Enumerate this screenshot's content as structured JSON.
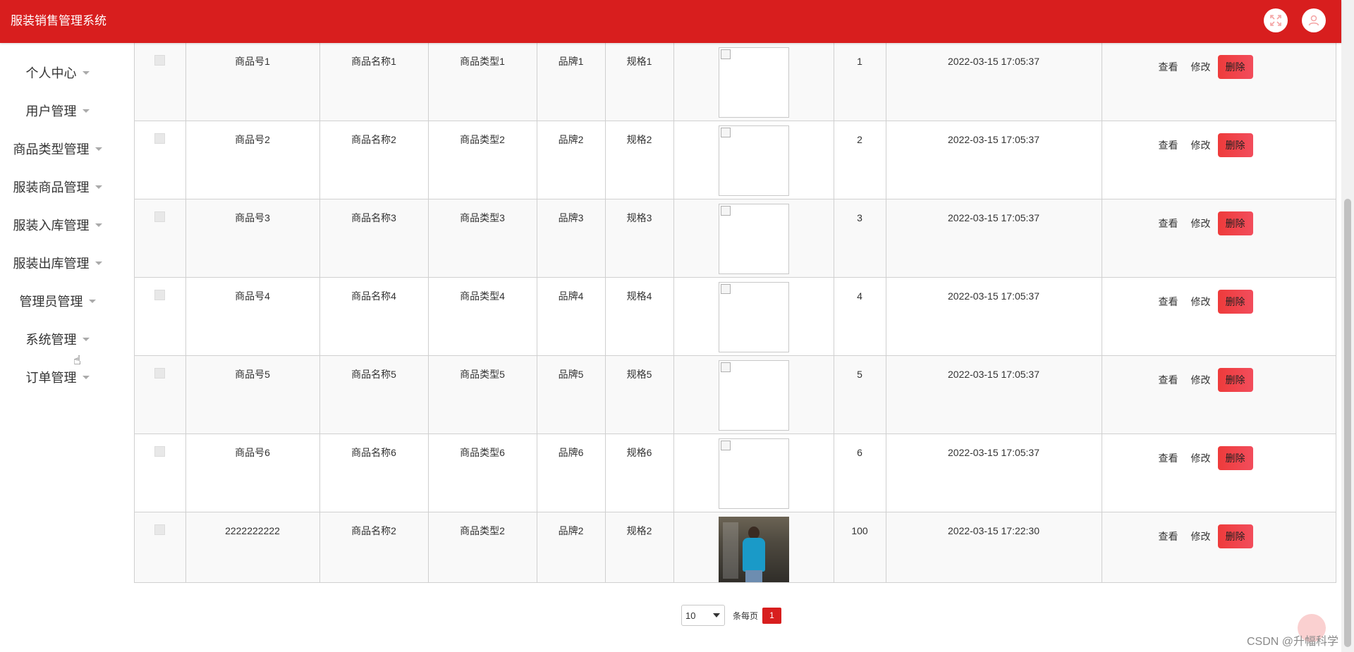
{
  "app": {
    "title": "服装销售管理系统"
  },
  "header": {
    "fullscreen_icon": "fullscreen-icon",
    "user_icon": "user-icon"
  },
  "sidebar": {
    "items": [
      {
        "label": "个人中心"
      },
      {
        "label": "用户管理"
      },
      {
        "label": "商品类型管理"
      },
      {
        "label": "服装商品管理"
      },
      {
        "label": "服装入库管理"
      },
      {
        "label": "服装出库管理"
      },
      {
        "label": "管理员管理"
      },
      {
        "label": "系统管理"
      },
      {
        "label": "订单管理"
      }
    ]
  },
  "table": {
    "rows": [
      {
        "code": "商品号1",
        "name": "商品名称1",
        "type": "商品类型1",
        "brand": "品牌1",
        "spec": "规格1",
        "image": "broken",
        "qty": "1",
        "time": "2022-03-15 17:05:37"
      },
      {
        "code": "商品号2",
        "name": "商品名称2",
        "type": "商品类型2",
        "brand": "品牌2",
        "spec": "规格2",
        "image": "broken",
        "qty": "2",
        "time": "2022-03-15 17:05:37"
      },
      {
        "code": "商品号3",
        "name": "商品名称3",
        "type": "商品类型3",
        "brand": "品牌3",
        "spec": "规格3",
        "image": "broken",
        "qty": "3",
        "time": "2022-03-15 17:05:37"
      },
      {
        "code": "商品号4",
        "name": "商品名称4",
        "type": "商品类型4",
        "brand": "品牌4",
        "spec": "规格4",
        "image": "broken",
        "qty": "4",
        "time": "2022-03-15 17:05:37"
      },
      {
        "code": "商品号5",
        "name": "商品名称5",
        "type": "商品类型5",
        "brand": "品牌5",
        "spec": "规格5",
        "image": "broken",
        "qty": "5",
        "time": "2022-03-15 17:05:37"
      },
      {
        "code": "商品号6",
        "name": "商品名称6",
        "type": "商品类型6",
        "brand": "品牌6",
        "spec": "规格6",
        "image": "broken",
        "qty": "6",
        "time": "2022-03-15 17:05:37"
      },
      {
        "code": "2222222222",
        "name": "商品名称2",
        "type": "商品类型2",
        "brand": "品牌2",
        "spec": "规格2",
        "image": "photo",
        "qty": "100",
        "time": "2022-03-15 17:22:30"
      }
    ],
    "actions": {
      "view": "查看",
      "edit": "修改",
      "delete": "删除"
    }
  },
  "pagination": {
    "page_size": "10",
    "per_page_label": "条每页",
    "current_page": "1"
  },
  "watermark": "CSDN @升幅科学",
  "colors": {
    "brand": "#d81e1e",
    "delete": "#f0414f"
  }
}
